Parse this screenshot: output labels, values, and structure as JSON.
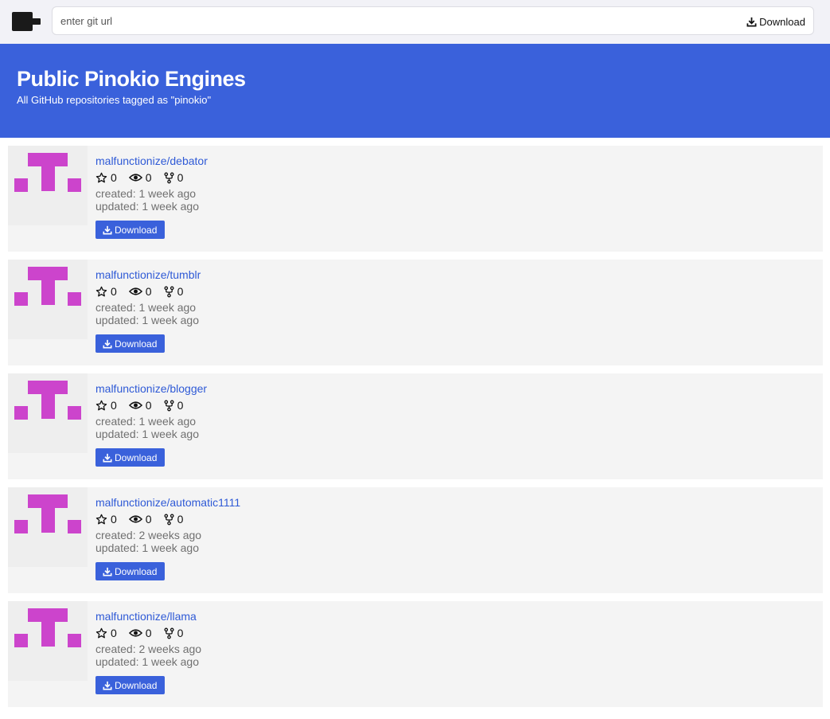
{
  "header": {
    "url_placeholder": "enter git url",
    "download_label": "Download"
  },
  "hero": {
    "title": "Public Pinokio Engines",
    "subtitle": "All GitHub repositories tagged as \"pinokio\""
  },
  "colors": {
    "accent": "#3a61db",
    "link": "#2f5ad6",
    "logo_magenta": "#cc44cc",
    "card_bg": "#f4f4f4"
  },
  "icons": [
    "pinokio-logo-icon",
    "download-icon",
    "star-icon",
    "eye-icon",
    "fork-icon",
    "repo-avatar-icon"
  ],
  "repos": [
    {
      "name": "malfunctionize/debator",
      "stars": "0",
      "watchers": "0",
      "forks": "0",
      "created": "created: 1 week ago",
      "updated": "updated: 1 week ago",
      "download_label": "Download"
    },
    {
      "name": "malfunctionize/tumblr",
      "stars": "0",
      "watchers": "0",
      "forks": "0",
      "created": "created: 1 week ago",
      "updated": "updated: 1 week ago",
      "download_label": "Download"
    },
    {
      "name": "malfunctionize/blogger",
      "stars": "0",
      "watchers": "0",
      "forks": "0",
      "created": "created: 1 week ago",
      "updated": "updated: 1 week ago",
      "download_label": "Download"
    },
    {
      "name": "malfunctionize/automatic1111",
      "stars": "0",
      "watchers": "0",
      "forks": "0",
      "created": "created: 2 weeks ago",
      "updated": "updated: 1 week ago",
      "download_label": "Download"
    },
    {
      "name": "malfunctionize/llama",
      "stars": "0",
      "watchers": "0",
      "forks": "0",
      "created": "created: 2 weeks ago",
      "updated": "updated: 1 week ago",
      "download_label": "Download"
    }
  ]
}
